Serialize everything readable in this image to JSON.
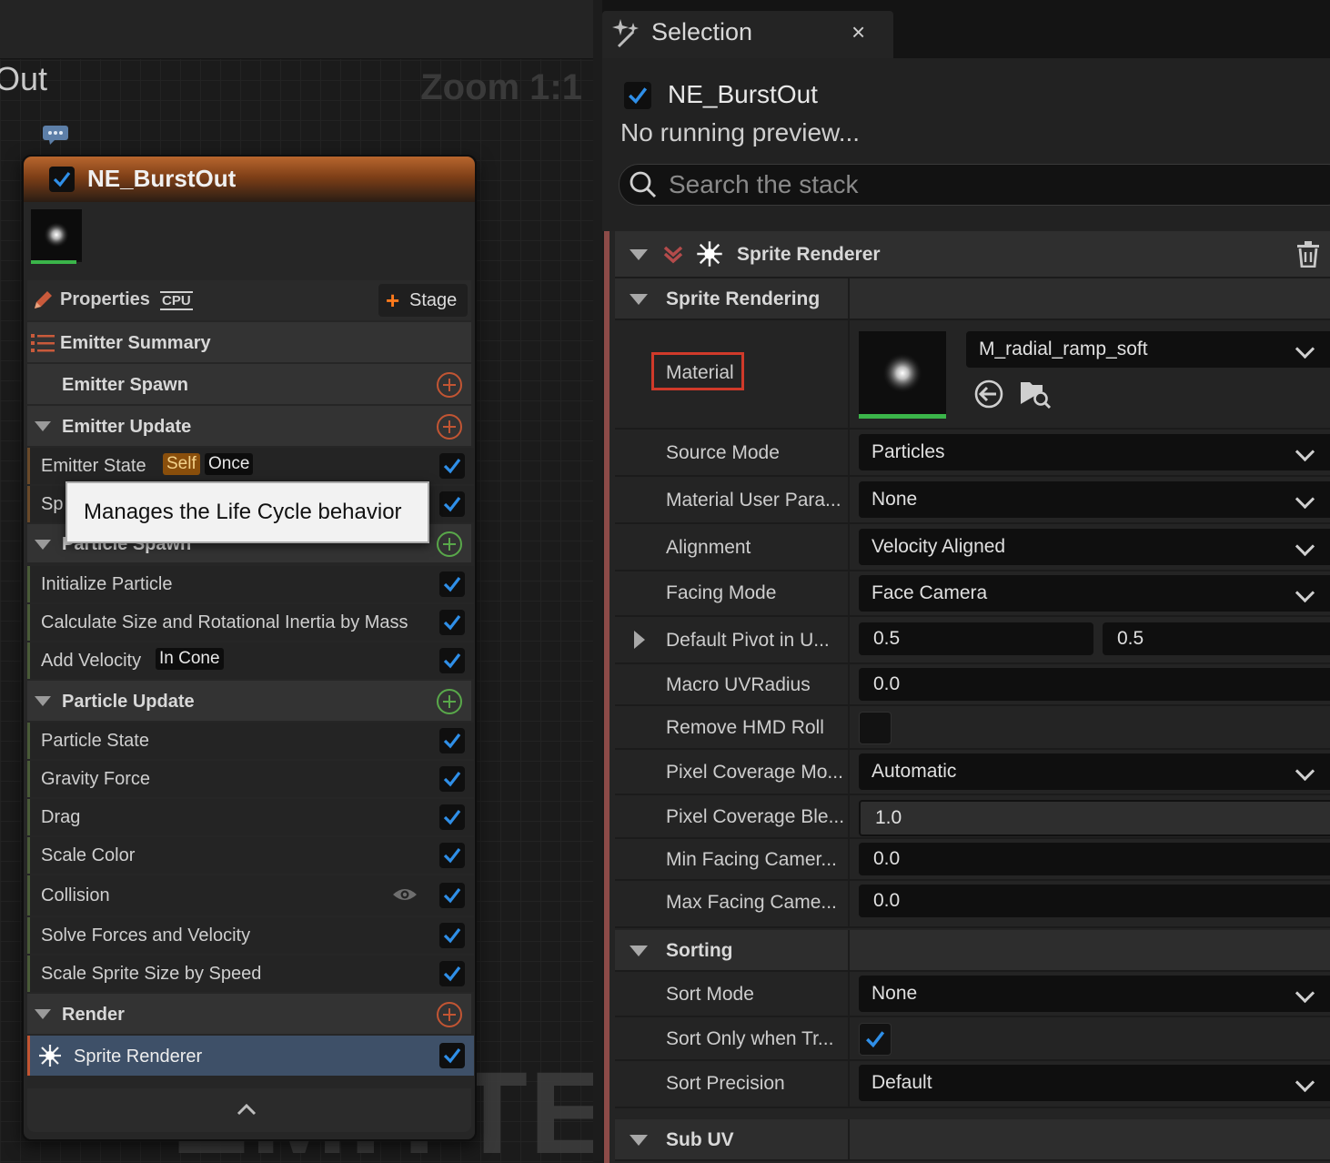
{
  "graph": {
    "title": "Out",
    "zoom": "Zoom 1:1",
    "watermark": "EMITTER"
  },
  "node": {
    "title": "NE_BurstOut",
    "enabled": true,
    "properties_label": "Properties",
    "sim_target": "CPU",
    "stage_button": "Stage",
    "rows": [
      {
        "label": "Emitter Summary"
      },
      {
        "label": "Emitter Spawn"
      },
      {
        "label": "Emitter Update"
      },
      {
        "label": "Emitter State",
        "tags": [
          "Self",
          "Once"
        ]
      },
      {
        "label": "Sp"
      },
      {
        "label": "Particle Spawn"
      },
      {
        "label": "Initialize Particle"
      },
      {
        "label": "Calculate Size and Rotational Inertia by Mass"
      },
      {
        "label": "Add Velocity",
        "tags": [
          "In Cone"
        ]
      },
      {
        "label": "Particle Update"
      },
      {
        "label": "Particle State"
      },
      {
        "label": "Gravity Force"
      },
      {
        "label": "Drag"
      },
      {
        "label": "Scale Color"
      },
      {
        "label": "Collision"
      },
      {
        "label": "Solve Forces and Velocity"
      },
      {
        "label": "Scale Sprite Size by Speed"
      },
      {
        "label": "Render"
      },
      {
        "label": "Sprite Renderer"
      }
    ],
    "tooltip": "Manages the Life Cycle behavior"
  },
  "panel": {
    "tab_title": "Selection",
    "close_glyph": "×",
    "selection_name": "NE_BurstOut",
    "status": "No running preview...",
    "search_placeholder": "Search the stack",
    "renderer_title": "Sprite Renderer",
    "categories": {
      "sprite_rendering": "Sprite Rendering",
      "sorting": "Sorting",
      "sub_uv": "Sub UV"
    },
    "material": {
      "label": "Material",
      "value": "M_radial_ramp_soft"
    },
    "props": [
      {
        "name": "Source Mode",
        "value": "Particles"
      },
      {
        "name": "Material User Para...",
        "value": "None"
      },
      {
        "name": "Alignment",
        "value": "Velocity Aligned"
      },
      {
        "name": "Facing Mode",
        "value": "Face Camera"
      },
      {
        "name": "Default Pivot in U...",
        "x": "0.5",
        "y": "0.5"
      },
      {
        "name": "Macro UVRadius",
        "value": "0.0"
      },
      {
        "name": "Remove HMD Roll",
        "checked": false
      },
      {
        "name": "Pixel Coverage Mo...",
        "value": "Automatic"
      },
      {
        "name": "Pixel Coverage Ble...",
        "value": "1.0"
      },
      {
        "name": "Min Facing Camer...",
        "value": "0.0"
      },
      {
        "name": "Max Facing Came...",
        "value": "0.0"
      },
      {
        "name": "Sort Mode",
        "value": "None"
      },
      {
        "name": "Sort Only when Tr...",
        "checked": true
      },
      {
        "name": "Sort Precision",
        "value": "Default"
      }
    ]
  },
  "colors": {
    "accent_blue": "#2f8fe8",
    "highlight_red": "#d03a2a",
    "tag_self": "#b56a10",
    "stack_accent": "#8c4b48"
  }
}
